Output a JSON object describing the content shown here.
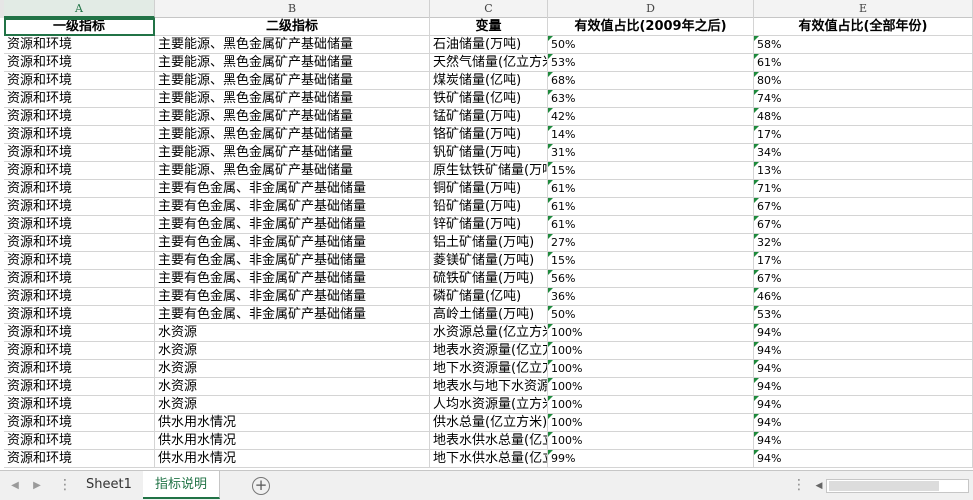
{
  "columns": [
    "A",
    "B",
    "C",
    "D",
    "E"
  ],
  "header_row": [
    "一级指标",
    "二级指标",
    "变量",
    "有效值占比(2009年之后)",
    "有效值占比(全部年份)"
  ],
  "rows": [
    [
      "资源和环境",
      "主要能源、黑色金属矿产基础储量",
      "石油储量(万吨)",
      "50%",
      "58%"
    ],
    [
      "资源和环境",
      "主要能源、黑色金属矿产基础储量",
      "天然气储量(亿立方米)",
      "53%",
      "61%"
    ],
    [
      "资源和环境",
      "主要能源、黑色金属矿产基础储量",
      "煤炭储量(亿吨)",
      "68%",
      "80%"
    ],
    [
      "资源和环境",
      "主要能源、黑色金属矿产基础储量",
      "铁矿储量(亿吨)",
      "63%",
      "74%"
    ],
    [
      "资源和环境",
      "主要能源、黑色金属矿产基础储量",
      "锰矿储量(万吨)",
      "42%",
      "48%"
    ],
    [
      "资源和环境",
      "主要能源、黑色金属矿产基础储量",
      "铬矿储量(万吨)",
      "14%",
      "17%"
    ],
    [
      "资源和环境",
      "主要能源、黑色金属矿产基础储量",
      "钒矿储量(万吨)",
      "31%",
      "34%"
    ],
    [
      "资源和环境",
      "主要能源、黑色金属矿产基础储量",
      "原生钛铁矿储量(万吨)",
      "15%",
      "13%"
    ],
    [
      "资源和环境",
      "主要有色金属、非金属矿产基础储量",
      "铜矿储量(万吨)",
      "61%",
      "71%"
    ],
    [
      "资源和环境",
      "主要有色金属、非金属矿产基础储量",
      "铅矿储量(万吨)",
      "61%",
      "67%"
    ],
    [
      "资源和环境",
      "主要有色金属、非金属矿产基础储量",
      "锌矿储量(万吨)",
      "61%",
      "67%"
    ],
    [
      "资源和环境",
      "主要有色金属、非金属矿产基础储量",
      "铝土矿储量(万吨)",
      "27%",
      "32%"
    ],
    [
      "资源和环境",
      "主要有色金属、非金属矿产基础储量",
      "菱镁矿储量(万吨)",
      "15%",
      "17%"
    ],
    [
      "资源和环境",
      "主要有色金属、非金属矿产基础储量",
      "硫铁矿储量(万吨)",
      "56%",
      "67%"
    ],
    [
      "资源和环境",
      "主要有色金属、非金属矿产基础储量",
      "磷矿储量(亿吨)",
      "36%",
      "46%"
    ],
    [
      "资源和环境",
      "主要有色金属、非金属矿产基础储量",
      "高岭土储量(万吨)",
      "50%",
      "53%"
    ],
    [
      "资源和环境",
      "水资源",
      "水资源总量(亿立方米)",
      "100%",
      "94%"
    ],
    [
      "资源和环境",
      "水资源",
      "地表水资源量(亿立方米)",
      "100%",
      "94%"
    ],
    [
      "资源和环境",
      "水资源",
      "地下水资源量(亿立方米)",
      "100%",
      "94%"
    ],
    [
      "资源和环境",
      "水资源",
      "地表水与地下水资源重复量",
      "100%",
      "94%"
    ],
    [
      "资源和环境",
      "水资源",
      "人均水资源量(立方米/人)",
      "100%",
      "94%"
    ],
    [
      "资源和环境",
      "供水用水情况",
      "供水总量(亿立方米)",
      "100%",
      "94%"
    ],
    [
      "资源和环境",
      "供水用水情况",
      "地表水供水总量(亿立方米)",
      "100%",
      "94%"
    ],
    [
      "资源和环境",
      "供水用水情况",
      "地下水供水总量(亿立方米)",
      "99%",
      "94%"
    ]
  ],
  "tabs": [
    "Sheet1",
    "指标说明"
  ],
  "active_tab": 1,
  "add_sheet_symbol": "+",
  "accent_color": "#217346"
}
